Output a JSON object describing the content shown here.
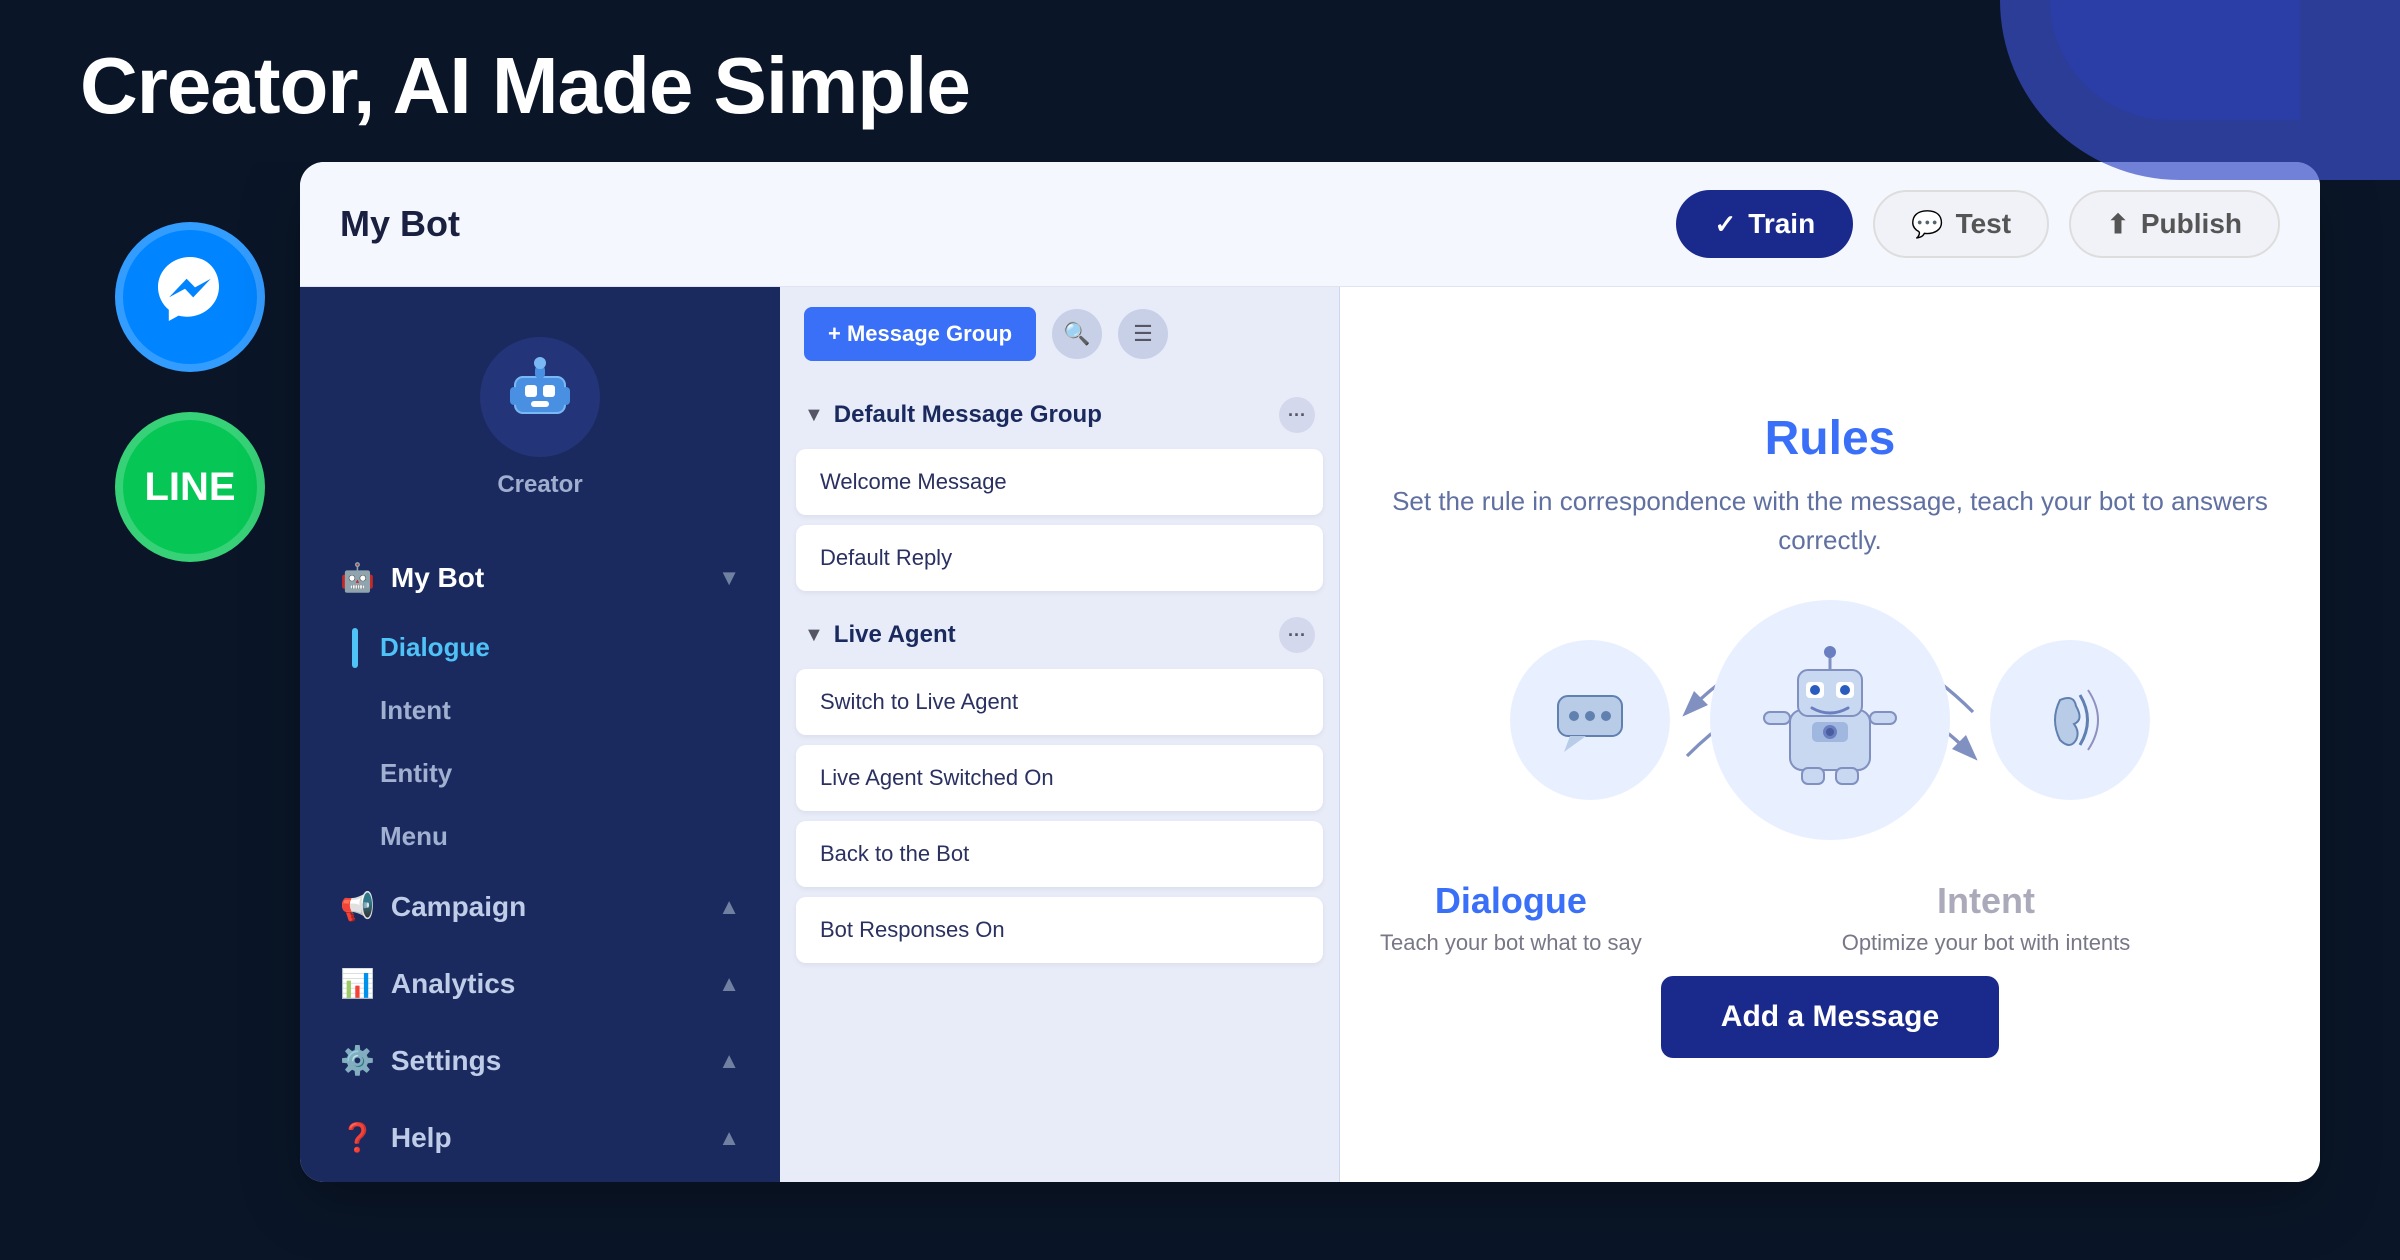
{
  "header": {
    "title": "Creator, AI Made Simple"
  },
  "topbar": {
    "app_title": "My Bot",
    "btn_train": "Train",
    "btn_test": "Test",
    "btn_publish": "Publish"
  },
  "creator_logo": {
    "label": "Creator"
  },
  "nav": {
    "my_bot": "My Bot",
    "dialogue": "Dialogue",
    "intent": "Intent",
    "entity": "Entity",
    "menu": "Menu",
    "campaign": "Campaign",
    "analytics": "Analytics",
    "settings": "Settings",
    "help": "Help"
  },
  "panel": {
    "add_group_btn": "+ Message Group",
    "groups": [
      {
        "name": "Default Message Group",
        "messages": [
          "Welcome Message",
          "Default Reply"
        ]
      },
      {
        "name": "Live Agent",
        "messages": [
          "Switch to Live Agent",
          "Live Agent Switched On",
          "Back to the Bot",
          "Bot Responses On"
        ]
      }
    ]
  },
  "rules": {
    "title": "Rules",
    "description": "Set the rule in correspondence with the message,\nteach your bot to answers correctly.",
    "dialogue_label": "Dialogue",
    "dialogue_desc": "Teach your bot what to say",
    "intent_label": "Intent",
    "intent_desc": "Optimize your bot with intents",
    "add_message_btn": "Add a Message"
  },
  "channels": [
    {
      "name": "messenger",
      "symbol": "💬"
    },
    {
      "name": "line",
      "symbol": "LINE"
    }
  ]
}
